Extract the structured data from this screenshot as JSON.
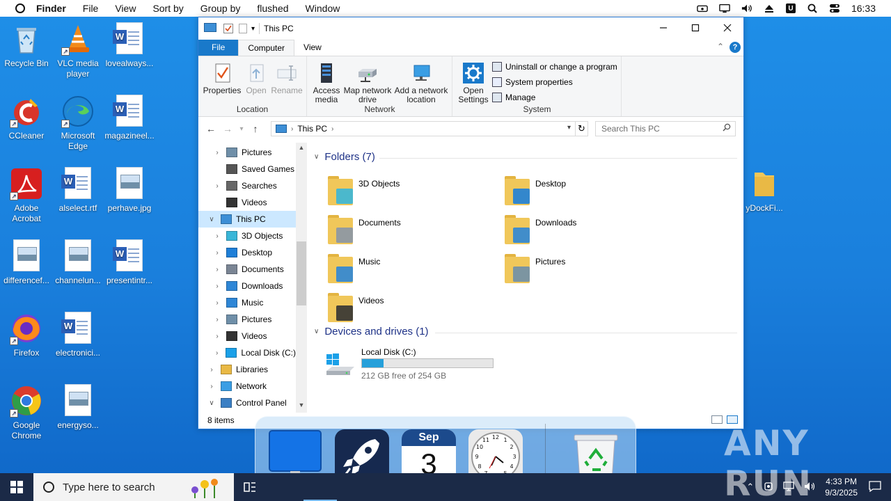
{
  "menubar": {
    "app": "Finder",
    "items": [
      "File",
      "View",
      "Sort by",
      "Group by",
      "flushed",
      "Window"
    ],
    "clock": "16:33",
    "badge": "U"
  },
  "desktop_icons": [
    {
      "label": "Recycle Bin",
      "icon": "recycle-bin-icon"
    },
    {
      "label": "VLC media player",
      "icon": "vlc-icon"
    },
    {
      "label": "lovealways...",
      "icon": "word-doc-icon"
    },
    {
      "label": "CCleaner",
      "icon": "ccleaner-icon"
    },
    {
      "label": "Microsoft Edge",
      "icon": "edge-icon"
    },
    {
      "label": "magazineel...",
      "icon": "word-doc-icon"
    },
    {
      "label": "Adobe Acrobat",
      "icon": "acrobat-icon"
    },
    {
      "label": "alselect.rtf",
      "icon": "word-doc-icon"
    },
    {
      "label": "perhave.jpg",
      "icon": "image-file-icon"
    },
    {
      "label": "differencef...",
      "icon": "image-file-icon"
    },
    {
      "label": "channelun...",
      "icon": "image-file-icon"
    },
    {
      "label": "presentintr...",
      "icon": "word-doc-icon"
    },
    {
      "label": "Firefox",
      "icon": "firefox-icon"
    },
    {
      "label": "electronici...",
      "icon": "word-doc-icon"
    },
    {
      "label": "Google Chrome",
      "icon": "chrome-icon"
    },
    {
      "label": "energyso...",
      "icon": "image-file-icon"
    },
    {
      "label": "yDockFi...",
      "icon": "folder-icon"
    }
  ],
  "explorer": {
    "title": "This PC",
    "tabs": {
      "file": "File",
      "computer": "Computer",
      "view": "View"
    },
    "ribbon": {
      "location": {
        "label": "Location",
        "properties": "Properties",
        "open": "Open",
        "rename": "Rename"
      },
      "network": {
        "label": "Network",
        "access_media": "Access media",
        "map_drive": "Map network drive",
        "add_location": "Add a network location"
      },
      "system": {
        "label": "System",
        "open_settings": "Open Settings",
        "uninstall": "Uninstall or change a program",
        "properties": "System properties",
        "manage": "Manage"
      }
    },
    "address": {
      "path": "This PC",
      "search_placeholder": "Search This PC"
    },
    "nav_items": [
      {
        "label": "Pictures",
        "indent": 1,
        "chev": true
      },
      {
        "label": "Saved Games",
        "indent": 1,
        "chev": false
      },
      {
        "label": "Searches",
        "indent": 1,
        "chev": true
      },
      {
        "label": "Videos",
        "indent": 1,
        "chev": false
      },
      {
        "label": "This PC",
        "indent": 0,
        "chev": true,
        "open": true,
        "selected": true
      },
      {
        "label": "3D Objects",
        "indent": 1,
        "chev": true
      },
      {
        "label": "Desktop",
        "indent": 1,
        "chev": true
      },
      {
        "label": "Documents",
        "indent": 1,
        "chev": true
      },
      {
        "label": "Downloads",
        "indent": 1,
        "chev": true
      },
      {
        "label": "Music",
        "indent": 1,
        "chev": true
      },
      {
        "label": "Pictures",
        "indent": 1,
        "chev": true
      },
      {
        "label": "Videos",
        "indent": 1,
        "chev": true
      },
      {
        "label": "Local Disk (C:)",
        "indent": 1,
        "chev": true
      },
      {
        "label": "Libraries",
        "indent": 0,
        "chev": true
      },
      {
        "label": "Network",
        "indent": 0,
        "chev": true
      },
      {
        "label": "Control Panel",
        "indent": 0,
        "chev": true,
        "open": true
      }
    ],
    "folders_header": "Folders (7)",
    "folders": [
      "3D Objects",
      "Desktop",
      "Documents",
      "Downloads",
      "Music",
      "Pictures",
      "Videos"
    ],
    "drives_header": "Devices and drives (1)",
    "drive": {
      "name": "Local Disk (C:)",
      "free": "212 GB free of 254 GB",
      "used_fraction": 0.165
    },
    "status": "8 items"
  },
  "dock": {
    "calendar_month": "Sep",
    "calendar_day": "3",
    "apps": [
      "finder-icon",
      "launchpad-rocket-icon",
      "calendar-icon",
      "clock-icon",
      "trash-icon"
    ]
  },
  "taskbar": {
    "search_placeholder": "Type here to search",
    "time": "4:33 PM",
    "date": "9/3/2025"
  },
  "watermark": "ANY RUN",
  "colors": {
    "accent": "#1979ca",
    "desktop": "#1a7fdc",
    "selection": "#cce8ff",
    "drive_fill": "#26a0da"
  }
}
